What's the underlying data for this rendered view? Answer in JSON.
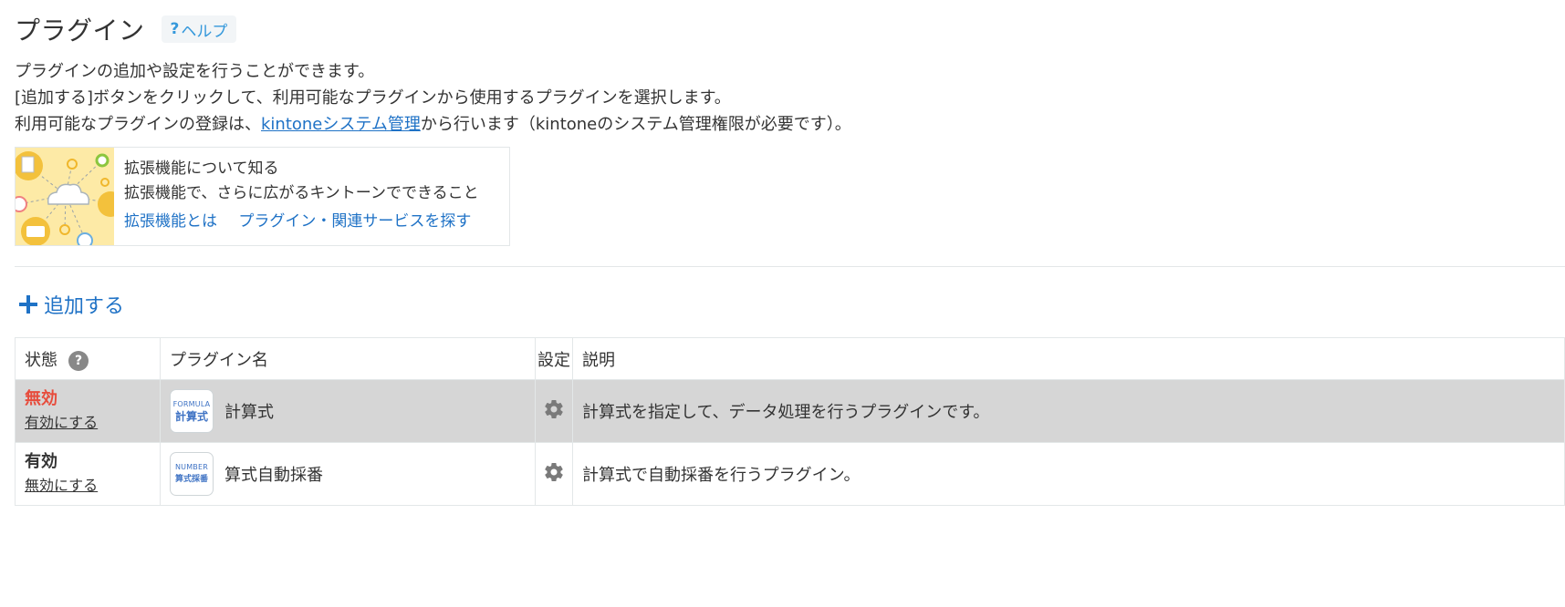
{
  "header": {
    "title": "プラグイン",
    "help_label": "ヘルプ",
    "help_mark": "?"
  },
  "description": {
    "line1": "プラグインの追加や設定を行うことができます。",
    "line2": "[追加する]ボタンをクリックして、利用可能なプラグインから使用するプラグインを選択します。",
    "line3_prefix": "利用可能なプラグインの登録は、",
    "line3_link": "kintoneシステム管理",
    "line3_suffix": "から行います（kintoneのシステム管理権限が必要です）。"
  },
  "extension_card": {
    "title": "拡張機能について知る",
    "subtitle": "拡張機能で、さらに広がるキントーンでできること",
    "link1": "拡張機能とは",
    "link2": "プラグイン・関連サービスを探す"
  },
  "add_button": {
    "label": "追加する"
  },
  "table": {
    "headers": {
      "state": "状態",
      "name": "プラグイン名",
      "settings": "設定",
      "description": "説明"
    },
    "help_mark": "?",
    "rows": [
      {
        "state": "無効",
        "toggle": "有効にする",
        "icon_top": "FORMULA",
        "icon_bottom": "計算式",
        "name": "計算式",
        "description": "計算式を指定して、データ処理を行うプラグインです。"
      },
      {
        "state": "有効",
        "toggle": "無効にする",
        "icon_top": "NUMBER",
        "icon_bottom": "算式採番",
        "name": "算式自動採番",
        "description": "計算式で自動採番を行うプラグイン。"
      }
    ]
  },
  "colors": {
    "link": "#1f72c6",
    "disabled_state": "#e74c3c",
    "disabled_row_bg": "#d6d6d6",
    "card_bg": "#fdeaa6"
  }
}
